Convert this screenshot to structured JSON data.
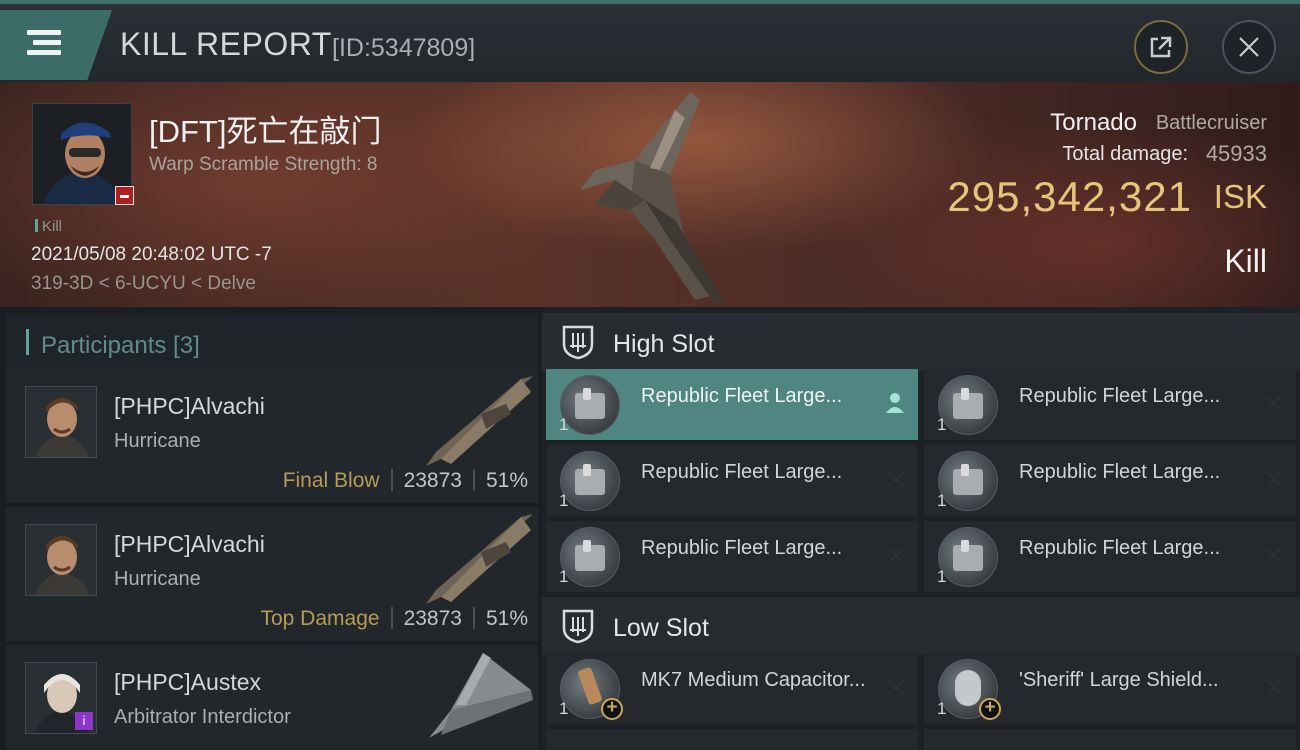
{
  "header": {
    "title": "KILL REPORT",
    "id_label": "[ID:5347809]"
  },
  "victim": {
    "name": "[DFT]死亡在敲门",
    "warp_scramble": "Warp Scramble Strength: 8",
    "tag": "Kill",
    "datetime": "2021/05/08 20:48:02 UTC -7",
    "location": "319-3D < 6-UCYU < Delve",
    "ship_name": "Tornado",
    "ship_class": "Battlecruiser",
    "total_damage_label": "Total damage:",
    "total_damage": "45933",
    "isk_value": "295,342,321",
    "isk_unit": "ISK",
    "result": "Kill"
  },
  "participants": {
    "label": "Participants [3]",
    "items": [
      {
        "name": "[PHPC]Alvachi",
        "ship": "Hurricane",
        "role": "Final Blow",
        "damage": "23873",
        "percent": "51%"
      },
      {
        "name": "[PHPC]Alvachi",
        "ship": "Hurricane",
        "role": "Top Damage",
        "damage": "23873",
        "percent": "51%"
      },
      {
        "name": "[PHPC]Austex",
        "ship": "Arbitrator Interdictor",
        "badge": "i"
      }
    ]
  },
  "fitting": {
    "high_slot_label": "High Slot",
    "low_slot_label": "Low Slot",
    "high_modules": [
      {
        "name": "Republic Fleet Large...",
        "qty": "1",
        "icon": "turret-icon"
      },
      {
        "name": "Republic Fleet Large...",
        "qty": "1",
        "icon": "turret-icon"
      },
      {
        "name": "Republic Fleet Large...",
        "qty": "1",
        "icon": "turret-icon"
      },
      {
        "name": "Republic Fleet Large...",
        "qty": "1",
        "icon": "turret-icon"
      },
      {
        "name": "Republic Fleet Large...",
        "qty": "1",
        "icon": "turret-icon"
      },
      {
        "name": "Republic Fleet Large...",
        "qty": "1",
        "icon": "turret-icon"
      }
    ],
    "low_modules": [
      {
        "name": "MK7 Medium Capacitor...",
        "qty": "1",
        "icon": "capacitor-icon"
      },
      {
        "name": "'Sheriff' Large Shield...",
        "qty": "1",
        "icon": "shield-extender-icon"
      }
    ]
  },
  "colors": {
    "accent_teal": "#4f8682",
    "isk_gold": "#e6c57b",
    "role_gold": "#b69a57"
  }
}
